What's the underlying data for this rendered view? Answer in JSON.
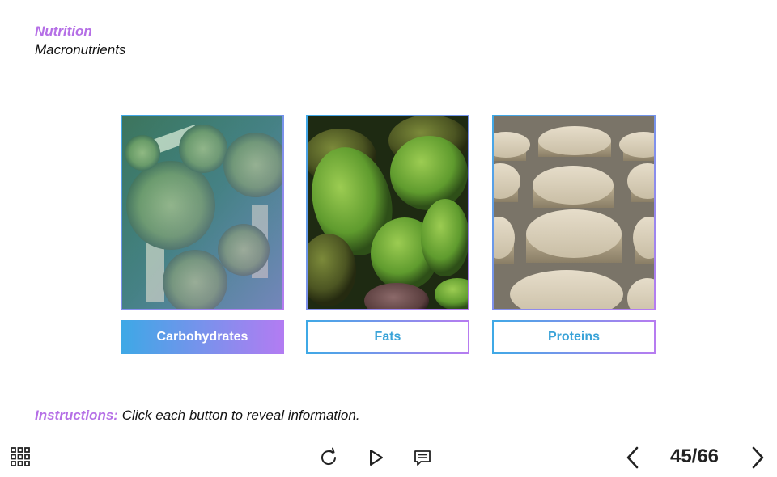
{
  "header": {
    "course": "Nutrition",
    "topic": "Macronutrients"
  },
  "cards": [
    {
      "label": "Carbohydrates",
      "image": "broccoli",
      "selected": true
    },
    {
      "label": "Fats",
      "image": "avocados",
      "selected": false
    },
    {
      "label": "Proteins",
      "image": "protein-discs",
      "selected": false
    }
  ],
  "instructions": {
    "lead": "Instructions:",
    "text": "Click each button to reveal information."
  },
  "toolbar": {
    "page_counter": "45/66",
    "icons": [
      "menu-grid-icon",
      "replay-icon",
      "play-icon",
      "notes-icon",
      "chevron-left-icon",
      "chevron-right-icon"
    ]
  },
  "colors": {
    "accent_purple": "#b56fe6",
    "accent_blue": "#3ea8e6",
    "text_dark": "#111111"
  }
}
